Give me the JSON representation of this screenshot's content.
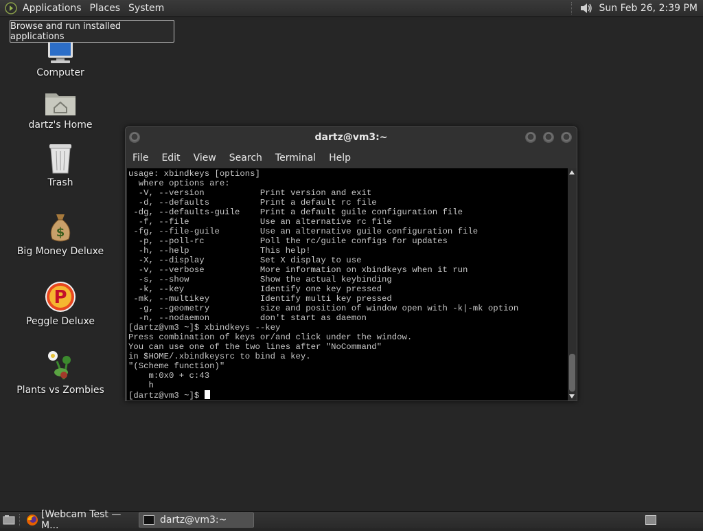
{
  "top_panel": {
    "menu": [
      "Applications",
      "Places",
      "System"
    ],
    "clock": "Sun Feb 26,  2:39 PM"
  },
  "tooltip": "Browse and run installed applications",
  "desktop_icons": [
    {
      "label": "Computer",
      "icon": "computer-icon"
    },
    {
      "label": "dartz's Home",
      "icon": "home-folder-icon"
    },
    {
      "label": "Trash",
      "icon": "trash-icon"
    },
    {
      "label": "Big Money Deluxe",
      "icon": "money-bag-icon"
    },
    {
      "label": "Peggle Deluxe",
      "icon": "peggle-icon"
    },
    {
      "label": "Plants vs Zombies",
      "icon": "plants-vs-zombies-icon"
    }
  ],
  "terminal": {
    "title": "dartz@vm3:~",
    "menu": [
      "File",
      "Edit",
      "View",
      "Search",
      "Terminal",
      "Help"
    ],
    "lines": [
      "usage: xbindkeys [options]",
      "  where options are:",
      "  -V, --version           Print version and exit",
      "  -d, --defaults          Print a default rc file",
      " -dg, --defaults-guile    Print a default guile configuration file",
      "  -f, --file              Use an alternative rc file",
      " -fg, --file-guile        Use an alternative guile configuration file",
      "  -p, --poll-rc           Poll the rc/guile configs for updates",
      "  -h, --help              This help!",
      "  -X, --display           Set X display to use",
      "  -v, --verbose           More information on xbindkeys when it run",
      "  -s, --show              Show the actual keybinding",
      "  -k, --key               Identify one key pressed",
      " -mk, --multikey          Identify multi key pressed",
      "  -g, --geometry          size and position of window open with -k|-mk option",
      "  -n, --nodaemon          don't start as daemon",
      "[dartz@vm3 ~]$ xbindkeys --key",
      "Press combination of keys or/and click under the window.",
      "You can use one of the two lines after \"NoCommand\"",
      "in $HOME/.xbindkeysrc to bind a key.",
      "\"(Scheme function)\"",
      "    m:0x0 + c:43",
      "    h"
    ],
    "prompt": "[dartz@vm3 ~]$ "
  },
  "taskbar": {
    "tasks": [
      "[Webcam Test — M...",
      "dartz@vm3:~"
    ]
  }
}
